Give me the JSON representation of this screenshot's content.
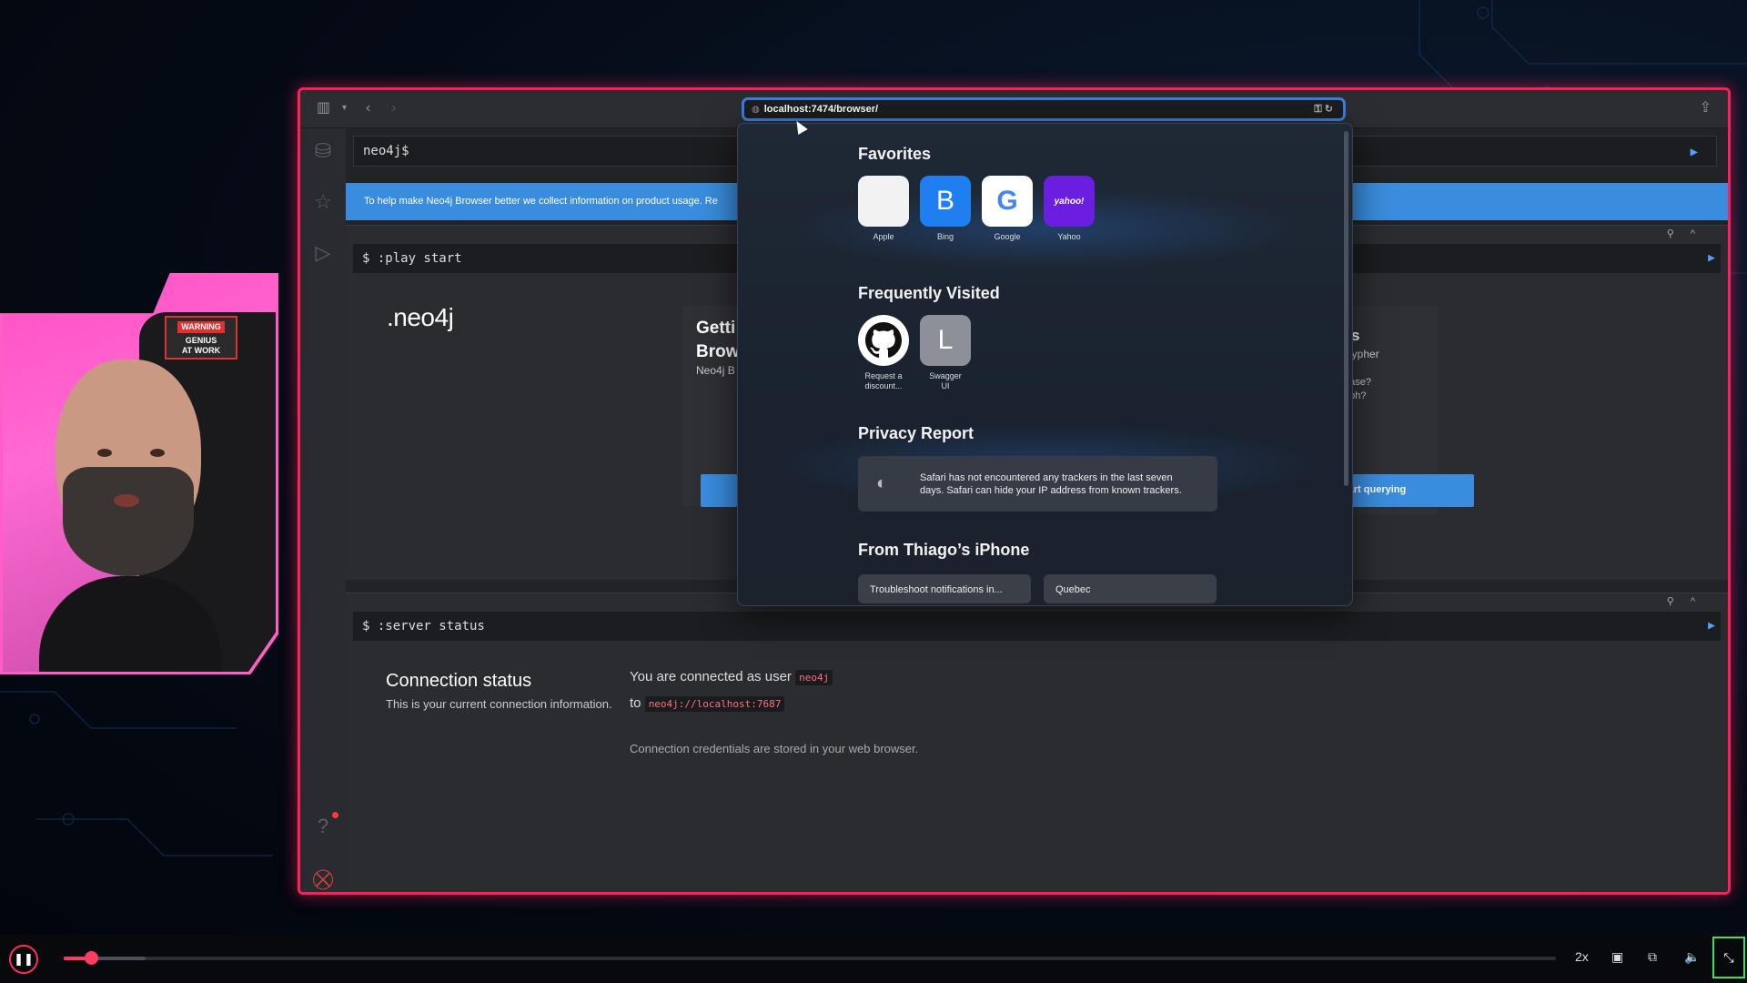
{
  "browser": {
    "url": "localhost:7474/browser/"
  },
  "editor": {
    "prompt": "neo4j$"
  },
  "banner": {
    "text": "To help make Neo4j Browser better we collect information on product usage. Re"
  },
  "play_frame": {
    "command": "$ :play start",
    "logo": ".neo4j",
    "getting_title_line1": "Getti",
    "getting_title_line2": "Brow",
    "getting_desc": "Neo4j B",
    "right_title": "s",
    "right_line1": "Cypher",
    "right_line2": "base?",
    "right_line3": "aph?",
    "query_button": "tart querying"
  },
  "server_frame": {
    "command": "$ :server status",
    "title": "Connection status",
    "subtitle": "This is your current connection information.",
    "connected_prefix": "You are connected as user",
    "user": "neo4j",
    "to_prefix": "to",
    "address": "neo4j://localhost:7687",
    "note": "Connection credentials are stored in your web browser."
  },
  "startpage": {
    "favorites_title": "Favorites",
    "favorites": [
      {
        "label": "Apple",
        "icon": "apple-icon",
        "glyph": "",
        "bg": "#f2f2f2",
        "fg": "#333333"
      },
      {
        "label": "Bing",
        "icon": "bing-icon",
        "glyph": "B",
        "bg": "#1f7ff0",
        "fg": "#ffffff"
      },
      {
        "label": "Google",
        "icon": "google-icon",
        "glyph": "G",
        "bg": "#ffffff",
        "fg": "#4285f4"
      },
      {
        "label": "Yahoo",
        "icon": "yahoo-icon",
        "glyph": "yahoo!",
        "bg": "#6a1fe0",
        "fg": "#ffffff"
      }
    ],
    "frequent_title": "Frequently Visited",
    "frequent": [
      {
        "label_line1": "Request a",
        "label_line2": "discount...",
        "icon": "github-icon"
      },
      {
        "label_line1": "Swagger",
        "label_line2": "UI",
        "icon": "letter-l-icon",
        "glyph": "L"
      }
    ],
    "privacy_title": "Privacy Report",
    "privacy_text_line1": "Safari has not encountered any trackers in the last seven",
    "privacy_text_line2": "days. Safari can hide your IP address from known trackers.",
    "iphone_title": "From Thiago’s iPhone",
    "iphone_items": [
      "Troubleshoot notifications in...",
      "Quebec"
    ]
  },
  "webcam": {
    "sign_top": "WARNING",
    "sign_line2": "GENIUS",
    "sign_line3": "AT WORK"
  },
  "player": {
    "speed": "2x",
    "progress_fraction": 0.02
  },
  "colors": {
    "frame_accent": "#ff1f5a",
    "neo4j_blue": "#3a8dde",
    "url_focus": "#3d7ddf"
  }
}
